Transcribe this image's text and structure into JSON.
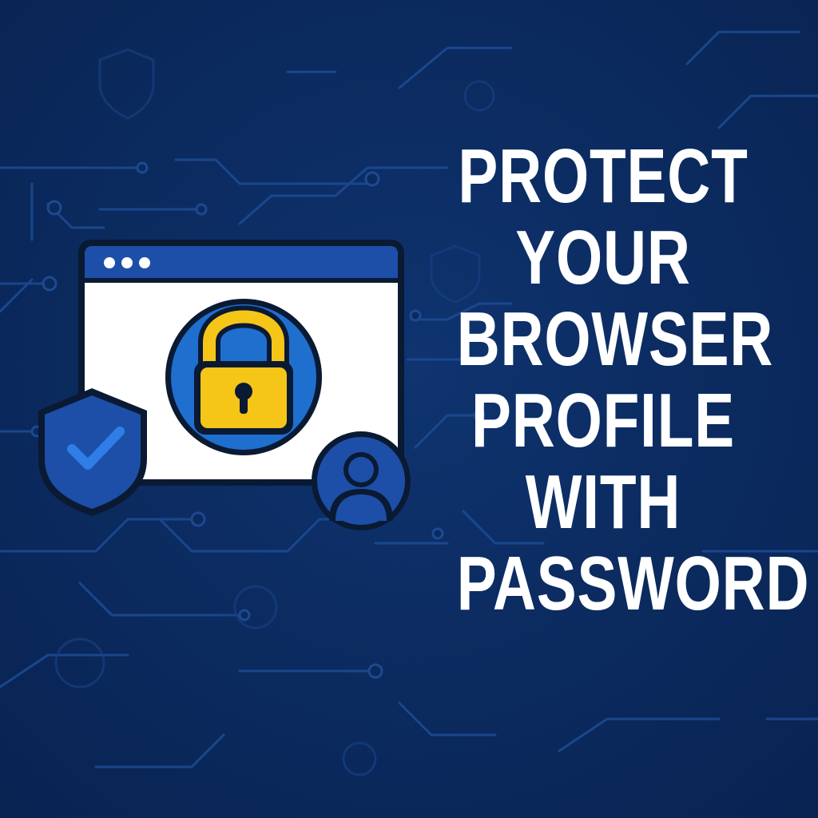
{
  "headline": {
    "lines": [
      "PROTECT",
      "YOUR",
      "BROWSER",
      "PROFILE",
      "WITH",
      "PASSWORD"
    ]
  },
  "colors": {
    "background": "#0b2a5e",
    "circuit": "#1c4a92",
    "window_bar": "#1d4fa8",
    "window_body": "#ffffff",
    "outline": "#0a1a33",
    "lock_circle": "#1f6fcf",
    "lock_body": "#f5c518",
    "shield": "#1d4fa8",
    "check": "#2f7ee8",
    "avatar_circle": "#1d4fa8",
    "text": "#ffffff"
  },
  "icons": [
    "window-icon",
    "padlock-icon",
    "shield-check-icon",
    "user-avatar-icon"
  ]
}
